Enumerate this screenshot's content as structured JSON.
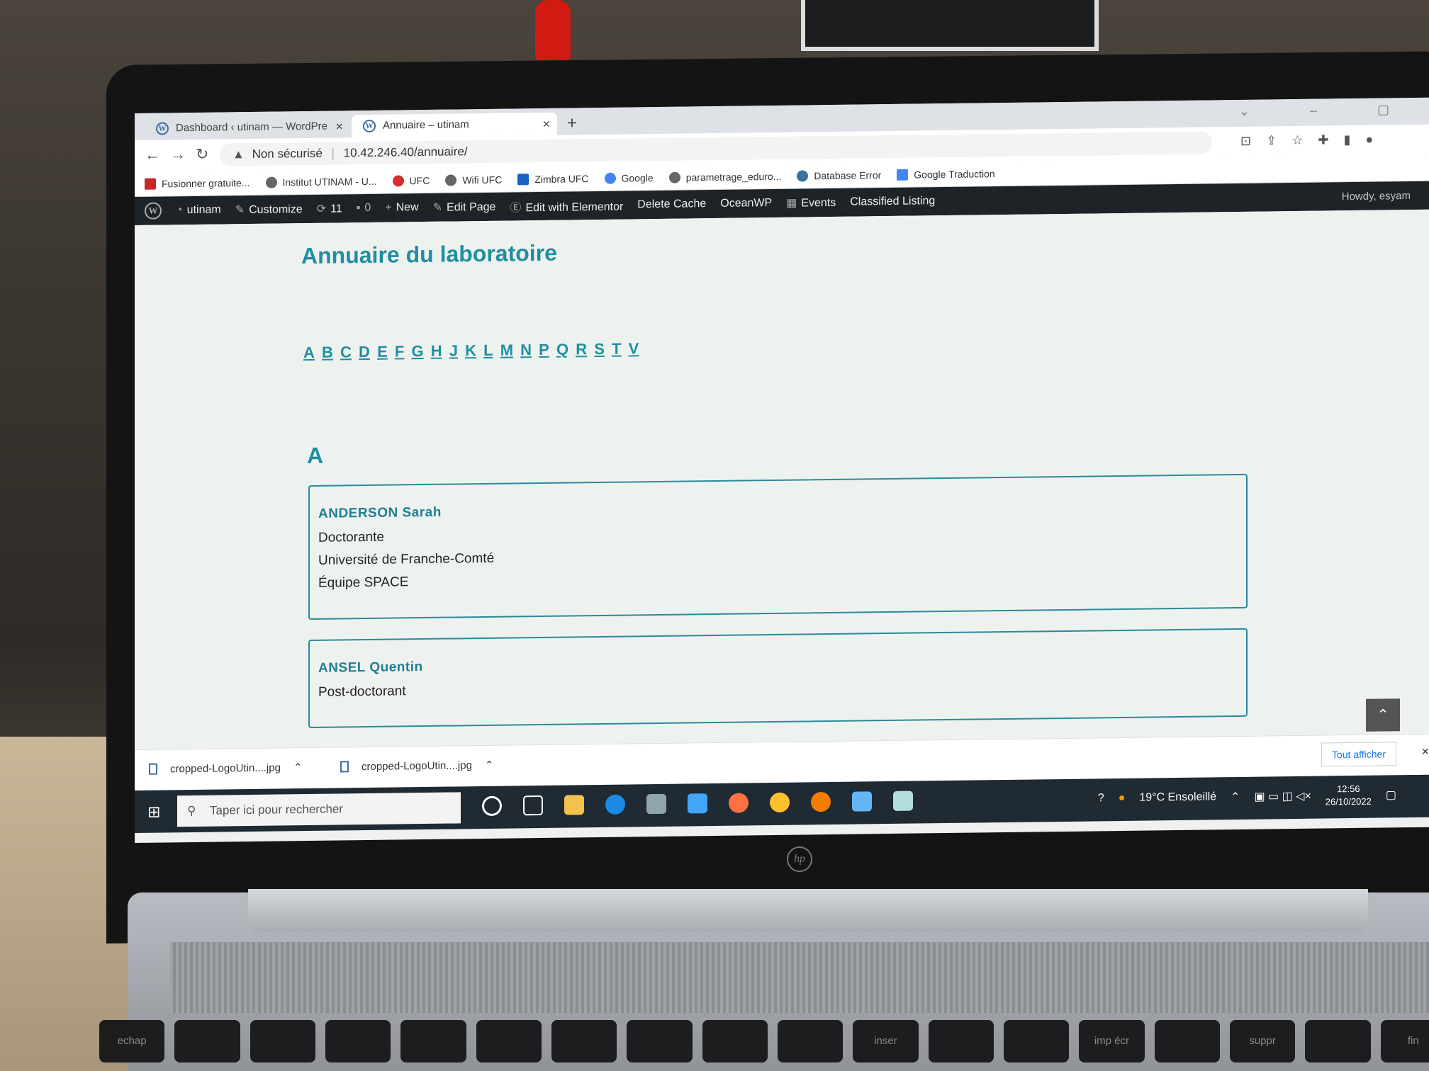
{
  "browser": {
    "tabs": [
      {
        "label": "Dashboard ‹ utinam — WordPre",
        "active": false
      },
      {
        "label": "Annuaire – utinam",
        "active": true
      }
    ],
    "security_label": "Non sécurisé",
    "url": "10.42.246.40/annuaire/",
    "bookmarks": [
      "Fusionner gratuite...",
      "Institut UTINAM - U...",
      "UFC",
      "Wifi UFC",
      "Zimbra UFC",
      "Google",
      "parametrage_eduro...",
      "Database Error",
      "Google Traduction"
    ]
  },
  "adminbar": {
    "site": "utinam",
    "customize": "Customize",
    "updates": "11",
    "comments": "0",
    "new": "New",
    "edit_page": "Edit Page",
    "elementor": "Edit with Elementor",
    "delete_cache": "Delete Cache",
    "oceanwp": "OceanWP",
    "events": "Events",
    "classified": "Classified Listing",
    "howdy": "Howdy, esyam"
  },
  "page": {
    "title": "Annuaire du laboratoire",
    "letters": [
      "A",
      "B",
      "C",
      "D",
      "E",
      "F",
      "G",
      "H",
      "J",
      "K",
      "L",
      "M",
      "N",
      "P",
      "Q",
      "R",
      "S",
      "T",
      "V"
    ],
    "section": "A",
    "people": [
      {
        "name": "ANDERSON Sarah",
        "lines": [
          "Doctorante",
          "Université de Franche-Comté",
          "Équipe SPACE"
        ]
      },
      {
        "name": "ANSEL Quentin",
        "lines": [
          "Post-doctorant"
        ]
      }
    ]
  },
  "downloads": {
    "items": [
      "cropped-LogoUtin....jpg",
      "cropped-LogoUtin....jpg"
    ],
    "show_all": "Tout afficher"
  },
  "taskbar": {
    "search_placeholder": "Taper ici pour rechercher",
    "weather": "19°C  Ensoleillé",
    "time": "12:56",
    "date": "26/10/2022"
  },
  "keyboard": {
    "keys": [
      "echap",
      "inser",
      "imp écr",
      "suppr",
      "fin"
    ]
  },
  "colors": {
    "accent": "#1f8ea0",
    "adminbar": "#1d2327",
    "card_border": "#2a8a9a"
  }
}
